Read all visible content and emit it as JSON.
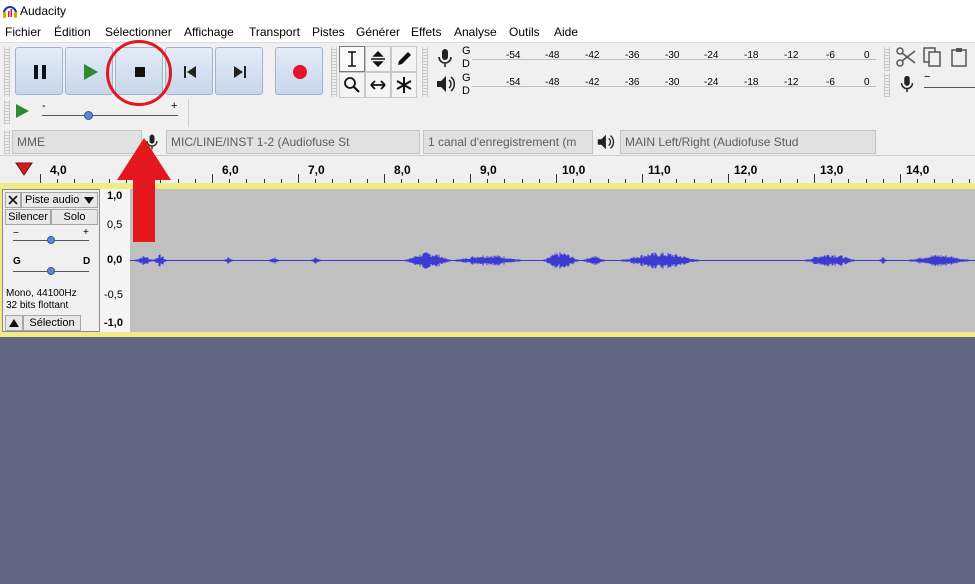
{
  "window": {
    "title": "Audacity"
  },
  "menu": [
    "Fichier",
    "Édition",
    "Sélectionner",
    "Affichage",
    "Transport",
    "Pistes",
    "Générer",
    "Effets",
    "Analyse",
    "Outils",
    "Aide"
  ],
  "meters": {
    "record_label_g": "G",
    "record_label_d": "D",
    "play_label_g": "G",
    "play_label_d": "D",
    "ticks": [
      "-54",
      "-48",
      "-42",
      "-36",
      "-30",
      "-24",
      "-18",
      "-12",
      "-6",
      "0"
    ]
  },
  "device": {
    "host": "MME",
    "input": "MIC/LINE/INST 1-2 (Audiofuse St",
    "channels": "1 canal d'enregistrement (m",
    "output": "MAIN Left/Right (Audiofuse Stud"
  },
  "ruler": {
    "labels": [
      "4,0",
      "6,0",
      "7,0",
      "8,0",
      "9,0",
      "10,0",
      "11,0",
      "12,0",
      "13,0",
      "14,0"
    ]
  },
  "track": {
    "name": "Piste audio",
    "mute": "Silencer",
    "solo": "Solo",
    "gain_minus": "−",
    "gain_plus": "+",
    "pan_left": "G",
    "pan_right": "D",
    "info_line1": "Mono, 44100Hz",
    "info_line2": "32 bits flottant",
    "select": "Sélection",
    "scale": [
      "1,0",
      "0,5",
      "0,0",
      "-0,5",
      "-1,0"
    ]
  },
  "playback_speed": {
    "minus": "-",
    "plus": "+"
  },
  "colors": {
    "annotation": "#e4161e",
    "waveform": "#3b3bd4",
    "record": "#e5132e"
  }
}
